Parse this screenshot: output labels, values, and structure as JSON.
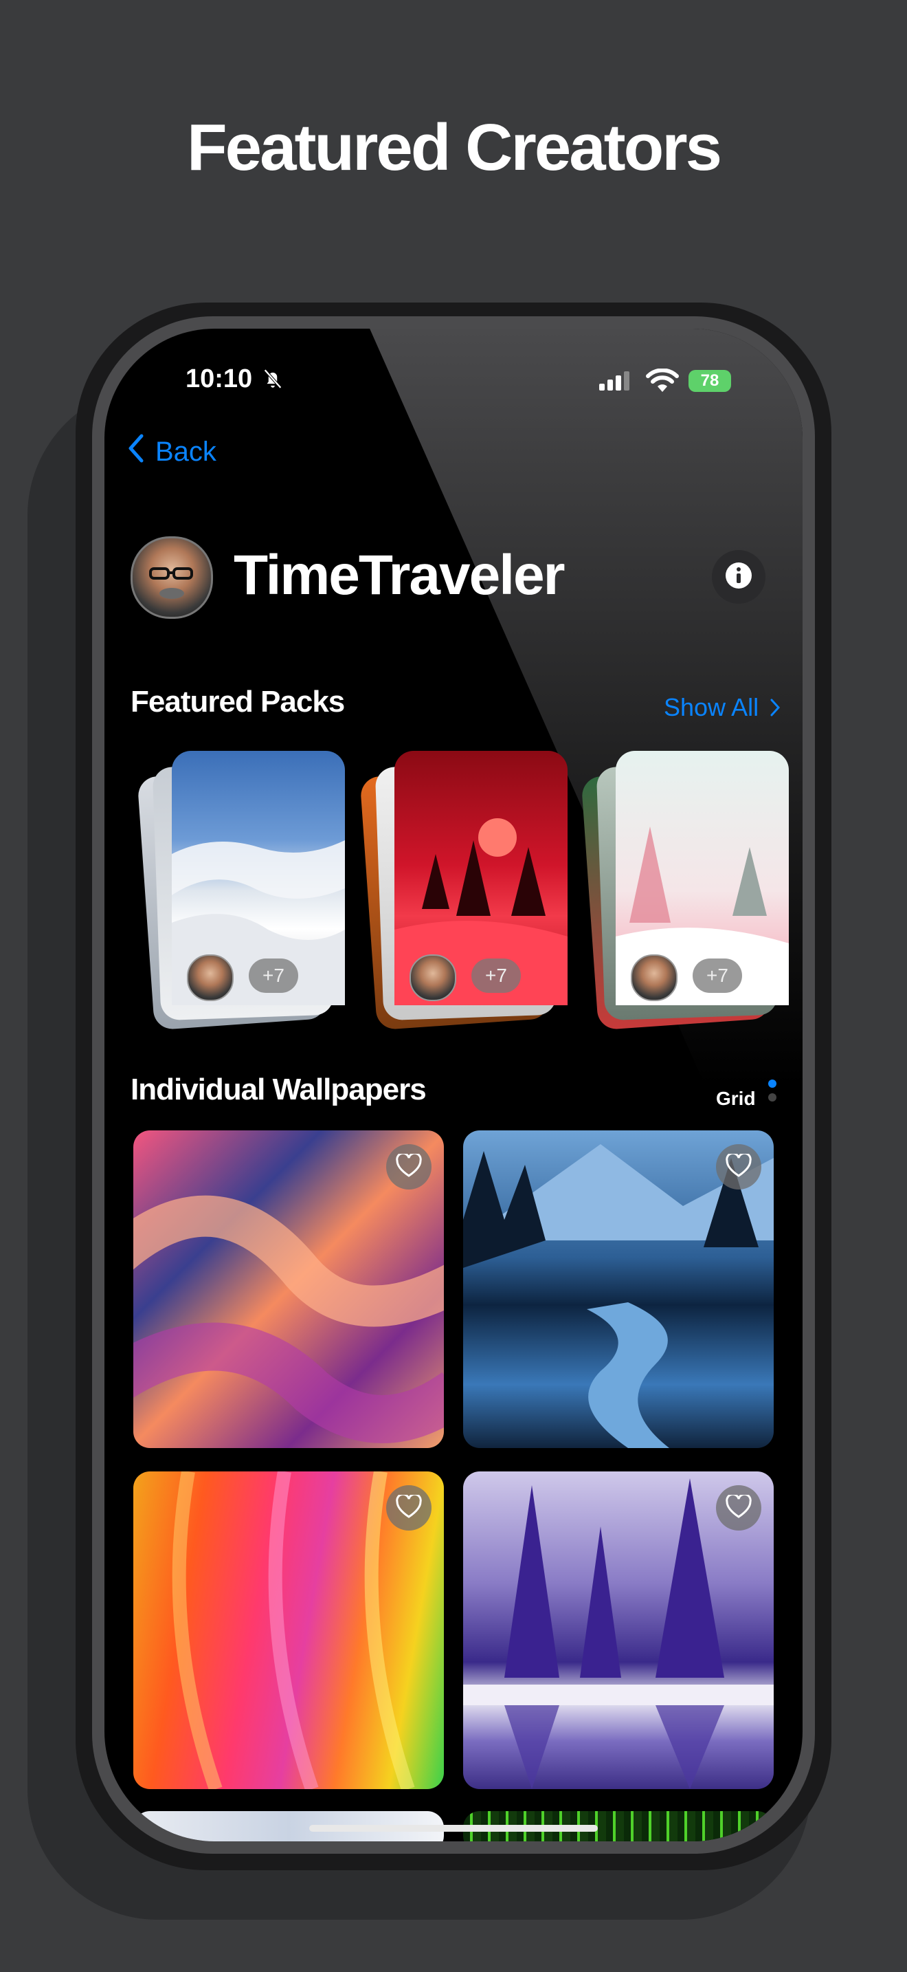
{
  "headline": "Featured Creators",
  "status_bar": {
    "time": "10:10",
    "battery": "78"
  },
  "nav": {
    "back_label": "Back"
  },
  "creator": {
    "name": "TimeTraveler"
  },
  "featured_packs": {
    "title": "Featured Packs",
    "show_all_label": "Show All",
    "packs": [
      {
        "more_count": "+7"
      },
      {
        "more_count": "+7"
      },
      {
        "more_count": "+7"
      }
    ]
  },
  "individual_wallpapers": {
    "title": "Individual Wallpapers",
    "view_mode": "Grid"
  },
  "colors": {
    "accent": "#0a84ff",
    "background": "#3a3b3d",
    "screen": "#000000"
  },
  "icons": [
    "chevron-left-icon",
    "bell-slash-icon",
    "cellular-signal-icon",
    "wifi-icon",
    "battery-icon",
    "info-icon",
    "chevron-right-icon",
    "heart-icon"
  ]
}
